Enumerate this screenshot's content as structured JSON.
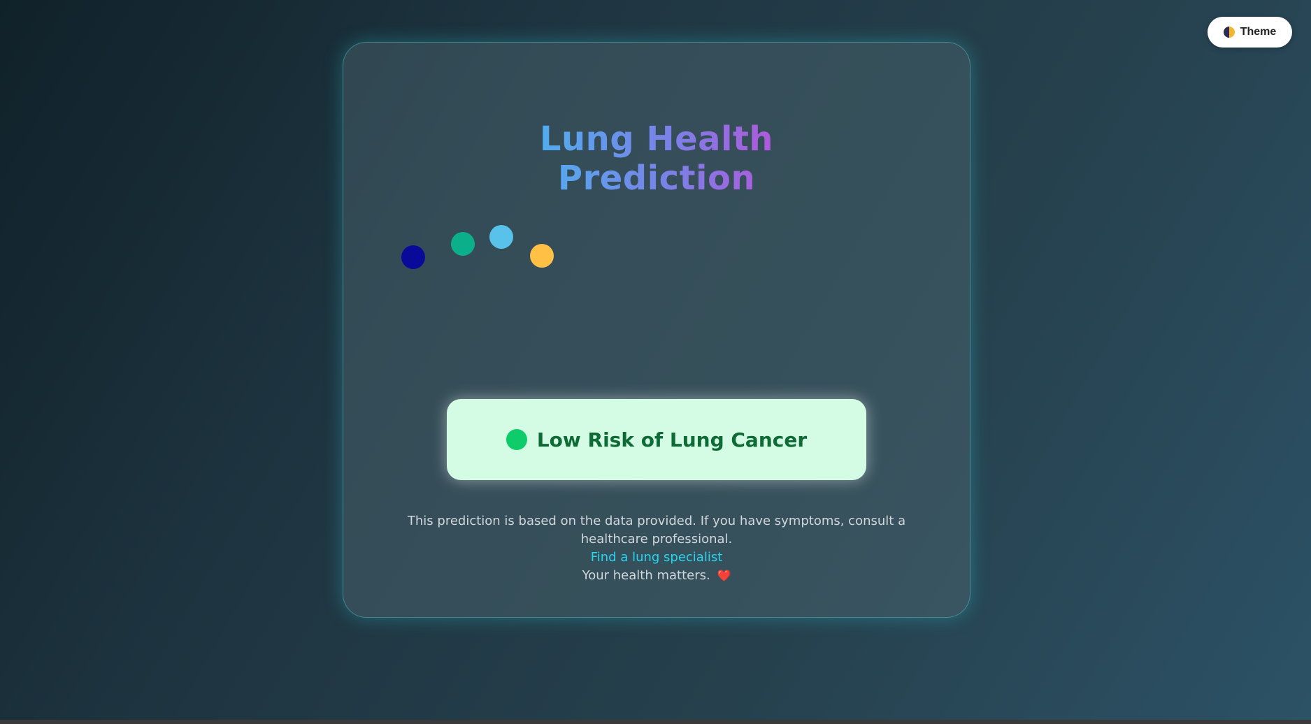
{
  "theme_button": {
    "icon": "half-moon-icon",
    "label": "Theme"
  },
  "card": {
    "title": "Lung Health Prediction",
    "loader_colors": [
      "#0a0a9a",
      "#0bb08a",
      "#58c2ea",
      "#ffc045"
    ],
    "result": {
      "status_color": "#0fcc6a",
      "text": "Low Risk of Lung Cancer"
    },
    "footer": {
      "disclaimer": "This prediction is based on the data provided. If you have symptoms, consult a healthcare professional.",
      "link_text": "Find a lung specialist",
      "closing": "Your health matters.",
      "heart_icon": "heart-icon",
      "heart_glyph": "❤️"
    }
  },
  "colors": {
    "accent_cyan": "#26d5ef",
    "result_bg": "#d4fbe4",
    "result_text": "#0f6b36"
  }
}
